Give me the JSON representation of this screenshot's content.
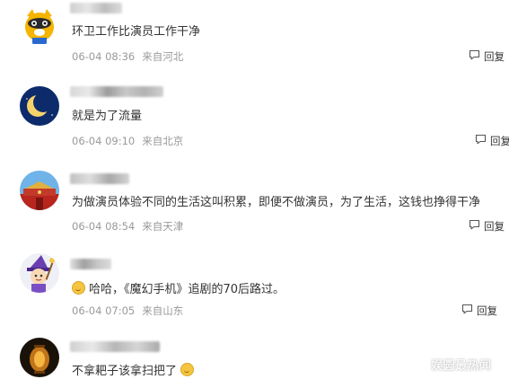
{
  "reply_label": "回复",
  "watermark": "娱圆最热闻",
  "comments": [
    {
      "avatar": "raccoon-mascot-avatar",
      "text": "环卫工作比演员工作干净",
      "time": "06-04 08:36",
      "location": "来自河北"
    },
    {
      "avatar": "crescent-moon-avatar",
      "text": "就是为了流量",
      "time": "06-04 09:10",
      "location": "来自北京"
    },
    {
      "avatar": "tiananmen-avatar",
      "text": "为做演员体验不同的生活这叫积累，即便不做演员，为了生活，这钱也挣得干净",
      "time": "06-04 08:54",
      "location": "来自天津"
    },
    {
      "avatar": "cartoon-witch-avatar",
      "text": "哈哈，《魔幻手机》追剧的70后路过。",
      "time": "06-04 07:05",
      "location": "来自山东"
    },
    {
      "avatar": "lantern-avatar",
      "text": "不拿耙子该拿扫把了"
    }
  ]
}
